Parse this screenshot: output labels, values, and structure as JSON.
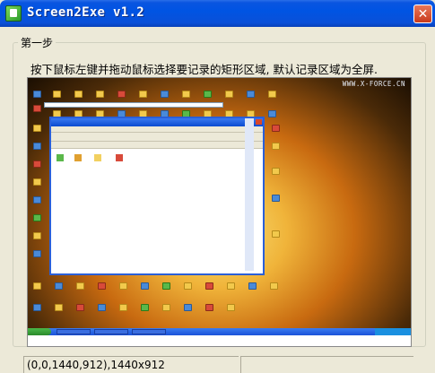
{
  "window": {
    "title": "Screen2Exe v1.2",
    "close_glyph": "✕"
  },
  "group": {
    "title": "第一步",
    "instruction": "按下鼠标左键并拖动鼠标选择要记录的矩形区域, 默认记录区域为全屏."
  },
  "preview": {
    "watermark": "WWW.X-FORCE.CN"
  },
  "status": {
    "region": "(0,0,1440,912),1440x912",
    "extra": ""
  },
  "colors": {
    "titlebar": "#0054e3",
    "dialog_bg": "#ECE9D8",
    "close": "#c83a1c"
  }
}
